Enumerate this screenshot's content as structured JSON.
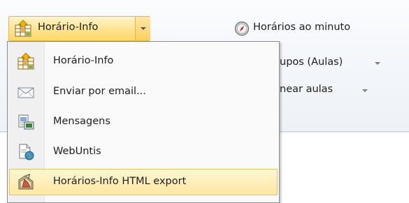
{
  "ribbon": {
    "split_button_label": "Horário-Info",
    "right_button_label": "Horários ao minuto",
    "grupos_label_partial": "upos (Aulas)",
    "planear_label_partial": "near aulas"
  },
  "menu": {
    "items": [
      {
        "label": "Horário-Info",
        "icon": "timetable-info-icon"
      },
      {
        "label": "Enviar por email...",
        "icon": "envelope-icon"
      },
      {
        "label": "Mensagens",
        "icon": "messages-icon"
      },
      {
        "label": "WebUntis",
        "icon": "webuntis-icon"
      },
      {
        "label": "Horários-Info HTML export",
        "icon": "html-export-icon"
      }
    ],
    "highlighted_index": 4
  },
  "colors": {
    "hover_fill": "#fde7a3",
    "hover_border": "#e5c365",
    "ribbon_bg": "#f3f6fa"
  }
}
